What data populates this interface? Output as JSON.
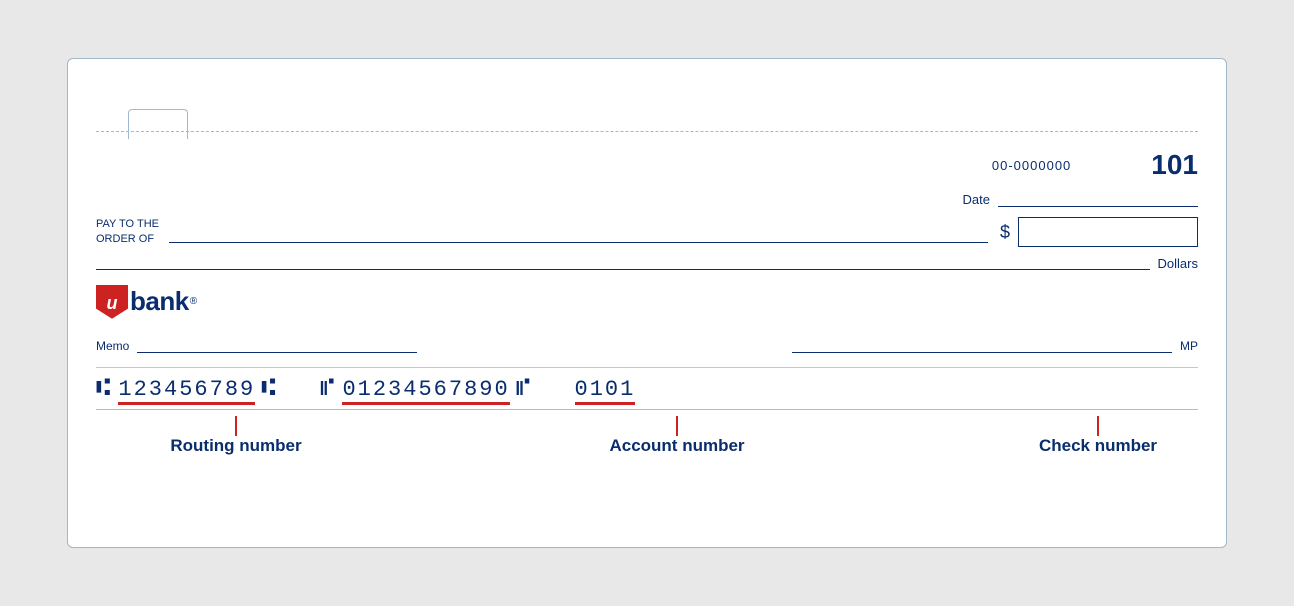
{
  "check": {
    "routing_display": "00-0000000",
    "check_number": "101",
    "date_label": "Date",
    "payto_label_line1": "PAY TO THE",
    "payto_label_line2": "ORDER OF",
    "dollar_sign": "$",
    "dollars_label": "Dollars",
    "memo_label": "Memo",
    "mp_label": "MP",
    "micr": {
      "routing_brackets_left": "⑆",
      "routing_number": "123456789",
      "routing_brackets_right": "⑆",
      "account_brackets_left": "⑈",
      "account_number": "01234567890",
      "account_brackets_right": "⑈",
      "check_number": "0101"
    },
    "labels": {
      "routing": "Routing number",
      "account": "Account number",
      "check": "Check number"
    }
  },
  "logo": {
    "shield_letter": "u",
    "bank_text": "bank",
    "reg_mark": "®"
  }
}
